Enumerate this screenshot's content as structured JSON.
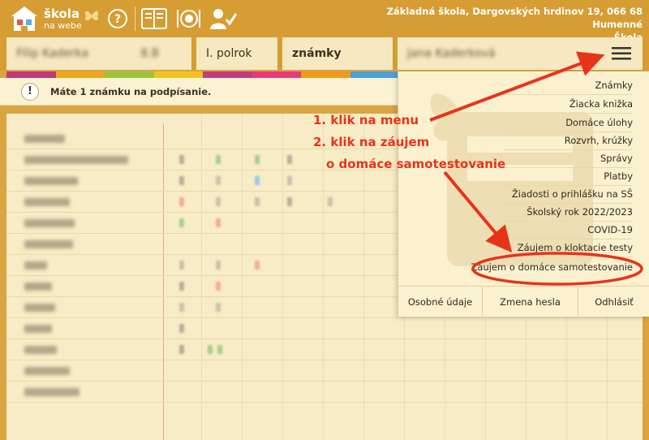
{
  "header": {
    "logo_line1": "škola",
    "logo_line2": "na webe",
    "school_line1": "Základná škola, Dargovských hrdinov 19, 066 68 Humenné",
    "school_line2": "Škola"
  },
  "selectors": {
    "student_name": "Filip Kaderka",
    "class": "8.B",
    "term": "I. polrok",
    "section": "známky",
    "parent_name": "Jana Kaderková"
  },
  "alert": {
    "text": "Máte 1 známku na podpísanie."
  },
  "menu": {
    "items": [
      "Známky",
      "Žiacka knižka",
      "Domáce úlohy",
      "Rozvrh, krúžky",
      "Správy",
      "Platby",
      "Žiadosti o prihlášku na SŠ",
      "Školský rok 2022/2023",
      "COVID-19",
      "Záujem o kloktacie testy",
      "Záujem o domáce samotestovanie"
    ],
    "footer": [
      "Osobné údaje",
      "Zmena hesla",
      "Odhlásiť"
    ]
  },
  "annotations": {
    "step1": "1. klik na menu",
    "step2": "2. klik na záujem",
    "step3": "o domáce samotestovanie"
  },
  "colors": {
    "header_bg": "#d59d33",
    "panel_bg": "#fbf1cf",
    "annotation_red": "#e8331b",
    "stripe": [
      "#c2387a",
      "#e8a91a",
      "#9bc43c",
      "#f0c420",
      "#c23b7e",
      "#e83a7a",
      "#f09a20",
      "#4aa0d8"
    ]
  }
}
